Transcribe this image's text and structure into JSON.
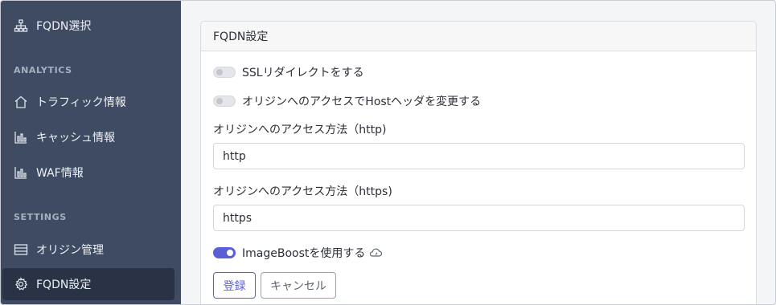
{
  "sidebar": {
    "items": [
      {
        "label": "FQDN選択",
        "icon": "sitemap-icon"
      },
      {
        "label": "トラフィック情報",
        "icon": "home-icon"
      },
      {
        "label": "キャッシュ情報",
        "icon": "bar-chart-icon"
      },
      {
        "label": "WAF情報",
        "icon": "bar-chart-icon"
      },
      {
        "label": "オリジン管理",
        "icon": "server-list-icon"
      },
      {
        "label": "FQDN設定",
        "icon": "gear-icon",
        "active": true
      }
    ],
    "headings": {
      "analytics": "ANALYTICS",
      "settings": "SETTINGS"
    }
  },
  "card": {
    "title": "FQDN設定",
    "ssl_redirect": {
      "label": "SSLリダイレクトをする",
      "on": false
    },
    "host_header": {
      "label": "オリジンへのアクセスでHostヘッダを変更する",
      "on": false
    },
    "http_method": {
      "label": "オリジンへのアクセス方法（http)",
      "value": "http"
    },
    "https_method": {
      "label": "オリジンへのアクセス方法（https)",
      "value": "https"
    },
    "image_boost": {
      "label": "ImageBoostを使用する",
      "on": true,
      "icon": "speedometer-cloud-icon"
    },
    "register_label": "登録",
    "cancel_label": "キャンセル"
  },
  "colors": {
    "sidebar_bg": "#3e4b63",
    "sidebar_active": "#2a3345",
    "accent": "#5b5fd6"
  }
}
